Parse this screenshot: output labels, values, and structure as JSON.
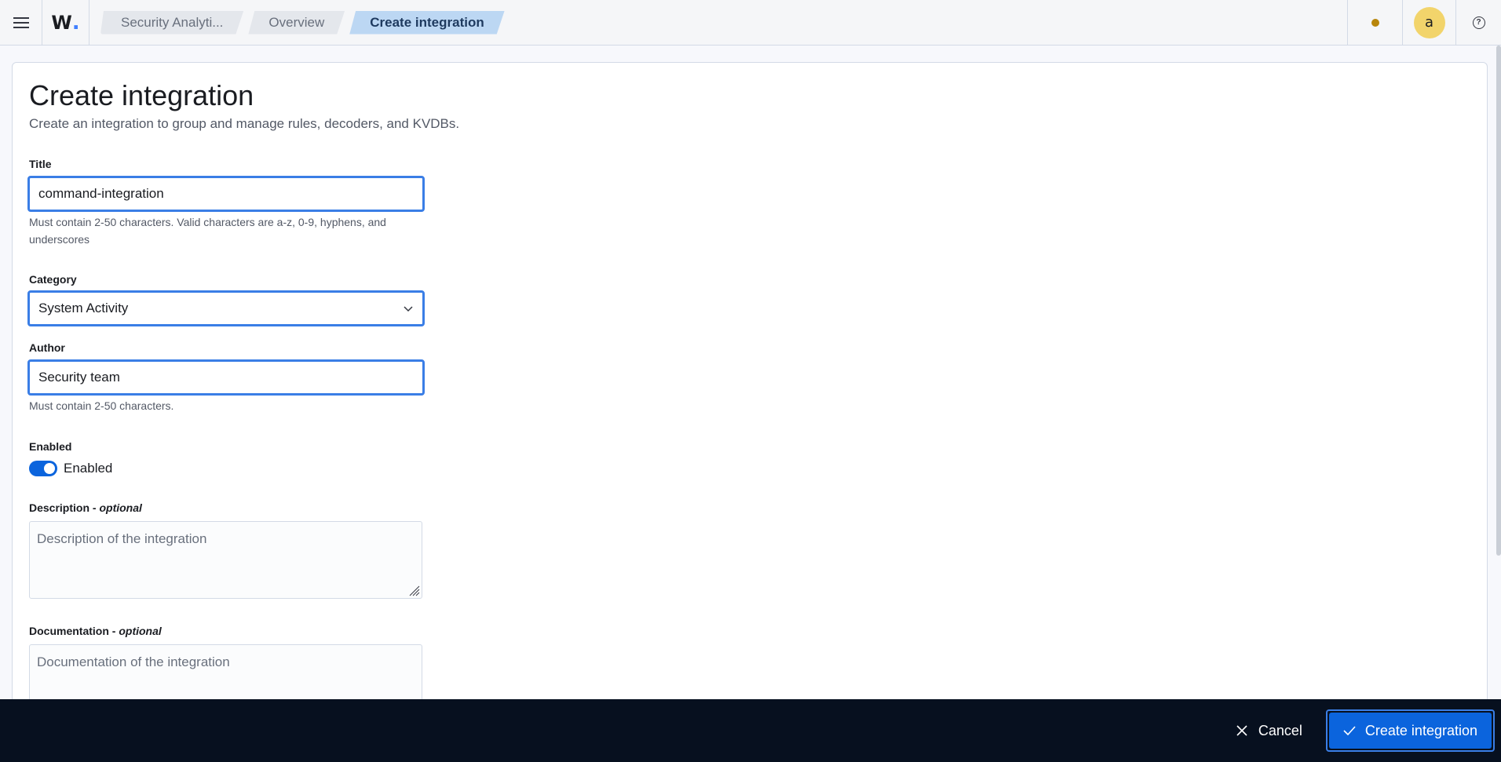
{
  "header": {
    "logo_text": "W",
    "logo_dot": ".",
    "breadcrumbs": [
      {
        "label": "Security Analyti..."
      },
      {
        "label": "Overview"
      },
      {
        "label": "Create integration"
      }
    ],
    "avatar_letter": "a",
    "help_icon": "?",
    "status_dot_color": "#b8860b"
  },
  "page": {
    "title": "Create integration",
    "description": "Create an integration to group and manage rules, decoders, and KVDBs."
  },
  "form": {
    "title_label": "Title",
    "title_value": "command-integration",
    "title_help": "Must contain 2-50 characters. Valid characters are a-z, 0-9, hyphens, and underscores",
    "category_label": "Category",
    "category_value": "System Activity",
    "author_label": "Author",
    "author_value": "Security team",
    "author_help": "Must contain 2-50 characters.",
    "enabled_label": "Enabled",
    "enabled_toggle_label": "Enabled",
    "enabled_state": true,
    "description_label": "Description",
    "description_optional": "optional",
    "description_placeholder": "Description of the integration",
    "documentation_label": "Documentation",
    "documentation_optional": "optional",
    "documentation_placeholder": "Documentation of the integration"
  },
  "footer": {
    "cancel_label": "Cancel",
    "create_label": "Create integration"
  },
  "colors": {
    "primary": "#0b64dd",
    "focus_border": "#3a7ee6",
    "bottom_bar": "#07101f",
    "active_crumb": "#bcd7f3"
  }
}
